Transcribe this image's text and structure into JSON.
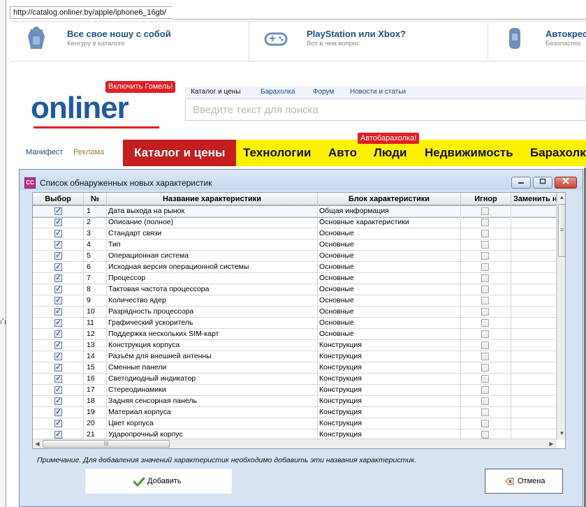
{
  "browser": {
    "url": "http://catalog.onliner.by/apple/iphone6_16gb/"
  },
  "promos": [
    {
      "title": "Все свое ношу с собой",
      "subtitle": "Кенгуру в каталоге",
      "icon": "backpack-icon"
    },
    {
      "title": "PlayStation или Xbox?",
      "subtitle": "Вот в чем вопрос",
      "icon": "gamepad-icon"
    },
    {
      "title": "Автокрес",
      "subtitle": "Безопаснос",
      "icon": "car-seat-icon"
    }
  ],
  "site": {
    "logo": "onliner",
    "city_button": "Включить Гомель!",
    "top_tabs": [
      "Каталог и цены",
      "Барахолка",
      "Форум",
      "Новости и статьи"
    ],
    "search_placeholder": "Введите текст для поиска",
    "manifest": "Манифест",
    "ads": "Реклама",
    "main_nav": [
      "Каталог и цены",
      "Технологии",
      "Авто",
      "Люди",
      "Недвижимость",
      "Барахолк"
    ],
    "auto_badge": "Автобарахолка!"
  },
  "dialog": {
    "title": "Список обнаруженных новых характеристик",
    "columns": [
      "Выбор",
      "№",
      "Название характеристики",
      "Блок характеристики",
      "Игнор",
      "Заменить н"
    ],
    "rows": [
      {
        "num": "1",
        "name": "Дата выхода на рынок",
        "block": "Общая информация"
      },
      {
        "num": "2",
        "name": "Описание (полное)",
        "block": "Основные характеристики"
      },
      {
        "num": "3",
        "name": "Стандарт связи",
        "block": "Основные"
      },
      {
        "num": "4",
        "name": "Тип",
        "block": "Основные"
      },
      {
        "num": "5",
        "name": "Операционная система",
        "block": "Основные"
      },
      {
        "num": "6",
        "name": "Исходная версия операционной системы",
        "block": "Основные"
      },
      {
        "num": "7",
        "name": "Процессор",
        "block": "Основные"
      },
      {
        "num": "8",
        "name": "Тактовая частота процессора",
        "block": "Основные"
      },
      {
        "num": "9",
        "name": "Количество ядер",
        "block": "Основные"
      },
      {
        "num": "10",
        "name": "Разрядность процессора",
        "block": "Основные"
      },
      {
        "num": "11",
        "name": "Графический ускоритель",
        "block": "Основные"
      },
      {
        "num": "12",
        "name": "Поддержка нескольких SIM-карт",
        "block": "Основные"
      },
      {
        "num": "13",
        "name": "Конструкция корпуса",
        "block": "Конструкция"
      },
      {
        "num": "14",
        "name": "Разъём для внешней антенны",
        "block": "Конструкция"
      },
      {
        "num": "15",
        "name": "Сменные панели",
        "block": "Конструкция"
      },
      {
        "num": "16",
        "name": "Светодиодный индикатор",
        "block": "Конструкция"
      },
      {
        "num": "17",
        "name": "Стереодинамики",
        "block": "Конструкция"
      },
      {
        "num": "18",
        "name": "Задняя сенсорная панель",
        "block": "Конструкция"
      },
      {
        "num": "19",
        "name": "Материал корпуса",
        "block": "Конструкция"
      },
      {
        "num": "20",
        "name": "Цвет корпуса",
        "block": "Конструкция"
      },
      {
        "num": "21",
        "name": "Ударопрочный корпус",
        "block": "Конструкция"
      }
    ],
    "note": "Примечание. Для добавления значений характеристик необходимо добавить эти названия характеристик.",
    "add_button": "Добавить",
    "cancel_button": "Отмена",
    "hscroll_grip": "III",
    "vscroll_grip": "≡"
  },
  "colors": {
    "brand_blue": "#1f5aa7",
    "accent_red": "#e31e24",
    "nav_yellow": "#fff200",
    "nav_active": "#c41e1e",
    "dialog_bg": "#d6e3f3"
  }
}
